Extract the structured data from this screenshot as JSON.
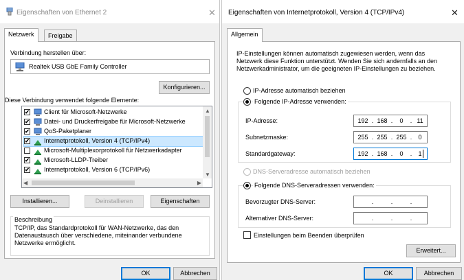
{
  "colors": {
    "dialog_bg": "#f0f0f0",
    "panel_bg": "#ffffff",
    "focus_border": "#0078d7",
    "selection_bg": "#cce8ff",
    "disabled_text": "#a0a0a0"
  },
  "win1": {
    "title": "Eigenschaften von Ethernet 2",
    "close": "✕",
    "tabs": [
      "Netzwerk",
      "Freigabe"
    ],
    "connect_label": "Verbindung herstellen über:",
    "adapter_name": "Realtek USB GbE Family Controller",
    "configure_button": "Konfigurieren...",
    "elements_label": "Diese Verbindung verwendet folgende Elemente:",
    "items": [
      {
        "label": "Client für Microsoft-Netzwerke",
        "checked": "✔",
        "icon": "network-client-icon"
      },
      {
        "label": "Datei- und Druckerfreigabe für Microsoft-Netzwerke",
        "checked": "✔",
        "icon": "network-service-icon"
      },
      {
        "label": "QoS-Paketplaner",
        "checked": "✔",
        "icon": "network-service-icon"
      },
      {
        "label": "Internetprotokoll, Version 4 (TCP/IPv4)",
        "checked": "✔",
        "icon": "protocol-icon",
        "selected": true
      },
      {
        "label": "Microsoft-Multiplexorprotokoll für Netzwerkadapter",
        "checked": "",
        "icon": "protocol-icon"
      },
      {
        "label": "Microsoft-LLDP-Treiber",
        "checked": "✔",
        "icon": "protocol-icon"
      },
      {
        "label": "Internetprotokoll, Version 6 (TCP/IPv6)",
        "checked": "✔",
        "icon": "protocol-icon"
      }
    ],
    "install_button": "Installieren...",
    "uninstall_button": "Deinstallieren",
    "properties_button": "Eigenschaften",
    "description_title": "Beschreibung",
    "description_text": [
      "TCP/IP, das Standardprotokoll für WAN-Netzwerke, das den",
      "Datenaustausch über verschiedene, miteinander verbundene",
      "Netzwerke ermöglicht."
    ],
    "ok_button": "OK",
    "cancel_button": "Abbrechen"
  },
  "win2": {
    "title": "Eigenschaften von Internetprotokoll, Version 4 (TCP/IPv4)",
    "close": "✕",
    "tab": "Allgemein",
    "intro": [
      "IP-Einstellungen können automatisch zugewiesen werden, wenn das",
      "Netzwerk diese Funktion unterstützt. Wenden Sie sich andernfalls an den",
      "Netzwerkadministrator, um die geeigneten IP-Einstellungen zu beziehen."
    ],
    "radio_auto_ip": "IP-Adresse automatisch beziehen",
    "radio_manual_ip": "Folgende IP-Adresse verwenden:",
    "ip_label": "IP-Adresse:",
    "ip_value": [
      "192",
      "168",
      "0",
      "11"
    ],
    "subnet_label": "Subnetzmaske:",
    "subnet_value": [
      "255",
      "255",
      "255",
      "0"
    ],
    "gateway_label": "Standardgateway:",
    "gateway_value": [
      "192",
      "168",
      "0",
      "1"
    ],
    "radio_auto_dns": "DNS-Serveradresse automatisch beziehen",
    "radio_manual_dns": "Folgende DNS-Serveradressen verwenden:",
    "dns_pref_label": "Bevorzugter DNS-Server:",
    "dns_alt_label": "Alternativer DNS-Server:",
    "dot": ".",
    "validate_label": "Einstellungen beim Beenden überprüfen",
    "advanced_button": "Erweitert...",
    "ok_button": "OK",
    "cancel_button": "Abbrechen"
  }
}
